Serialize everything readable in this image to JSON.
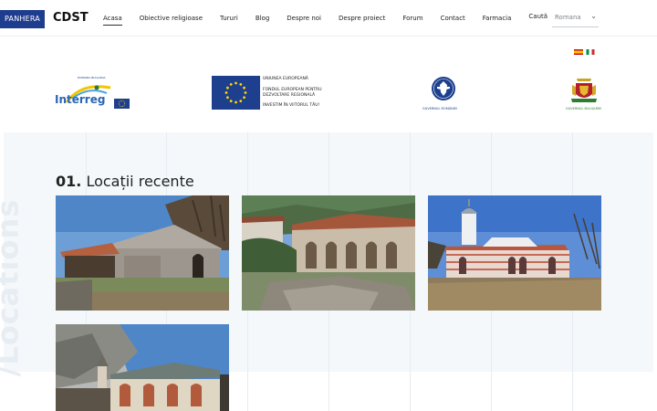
{
  "header": {
    "brand_box": "PANHERA",
    "brand_name": "CDST",
    "nav": [
      {
        "label": "Acasa",
        "active": true
      },
      {
        "label": "Obiective religioase",
        "active": false
      },
      {
        "label": "Tururi",
        "active": false
      },
      {
        "label": "Blog",
        "active": false
      },
      {
        "label": "Despre noi",
        "active": false
      },
      {
        "label": "Despre proiect",
        "active": false
      },
      {
        "label": "Forum",
        "active": false
      },
      {
        "label": "Contact",
        "active": false
      },
      {
        "label": "Farmacia",
        "active": false
      },
      {
        "label": "Caută",
        "active": false
      }
    ],
    "language": {
      "value": "Romana"
    }
  },
  "flags": [
    "spain-flag",
    "italy-flag"
  ],
  "logos": {
    "interreg": {
      "small_text": "ROMANIA BULGARIA",
      "wordmark": "Interreg"
    },
    "eu": {
      "lines": [
        "UNIUNEA EUROPEANĂ",
        "FONDUL EUROPEAN PENTRU",
        "DEZVOLTARE REGIONALĂ",
        "INVESTIM ÎN VIITORUL TĂU!"
      ]
    },
    "romania": {
      "caption": "GUVERNUL ROMÂNIEI"
    },
    "bulgaria": {
      "caption": "GUVERNUL BULGARIEI"
    }
  },
  "section": {
    "number": "01.",
    "title": "Locații recente",
    "vertical_text": "/Locations"
  },
  "colors": {
    "brand_blue": "#1f3d8f",
    "eu_blue": "#1d3f8e",
    "eu_star": "#ffd400",
    "section_bg": "#f4f8fb"
  }
}
